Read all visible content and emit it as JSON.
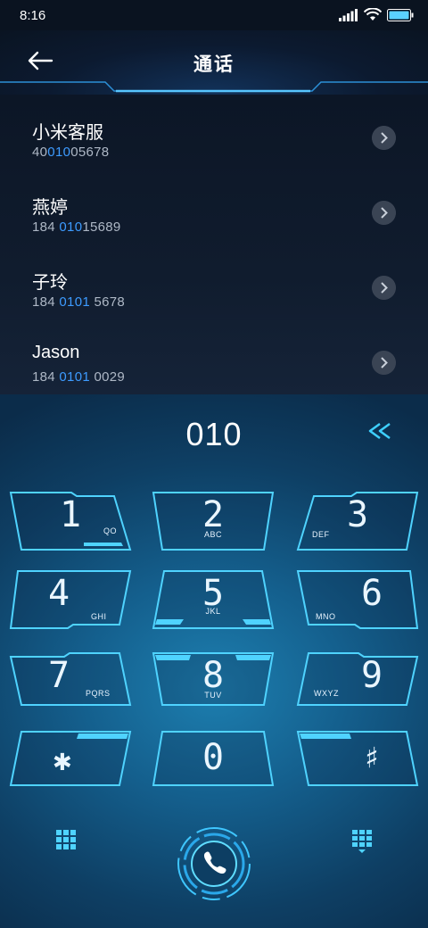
{
  "status_bar": {
    "time": "8:16"
  },
  "header": {
    "title": "通话"
  },
  "contacts": [
    {
      "name": "小米客服",
      "num_pre": "40",
      "num_hl": "010",
      "num_post": "05678"
    },
    {
      "name": "燕婷",
      "num_pre": "184 ",
      "num_hl": "010",
      "num_post": "15689"
    },
    {
      "name": "子玲",
      "num_pre": "184 ",
      "num_hl": "0101",
      "num_post": " 5678"
    },
    {
      "name": "Jason",
      "num_pre": "184 ",
      "num_hl": "0101",
      "num_post": " 0029"
    }
  ],
  "dialer": {
    "entered": "010",
    "keys": [
      {
        "digit": "1",
        "letters": "QO"
      },
      {
        "digit": "2",
        "letters": "ABC"
      },
      {
        "digit": "3",
        "letters": "DEF"
      },
      {
        "digit": "4",
        "letters": "GHI"
      },
      {
        "digit": "5",
        "letters": "JKL"
      },
      {
        "digit": "6",
        "letters": "MNO"
      },
      {
        "digit": "7",
        "letters": "PQRS"
      },
      {
        "digit": "8",
        "letters": "TUV"
      },
      {
        "digit": "9",
        "letters": "WXYZ"
      },
      {
        "digit": "✱",
        "letters": ""
      },
      {
        "digit": "0",
        "letters": ""
      },
      {
        "digit": "♯",
        "letters": ""
      }
    ]
  },
  "colors": {
    "accent": "#3d9bff",
    "key_outline": "#4fd3ff",
    "background": "#0b1422"
  },
  "icons": [
    "back-arrow-icon",
    "signal-icon",
    "wifi-icon",
    "battery-icon",
    "chevron-right-icon",
    "backspace-icon",
    "keypad-grid-icon",
    "hide-keypad-icon",
    "phone-icon"
  ]
}
